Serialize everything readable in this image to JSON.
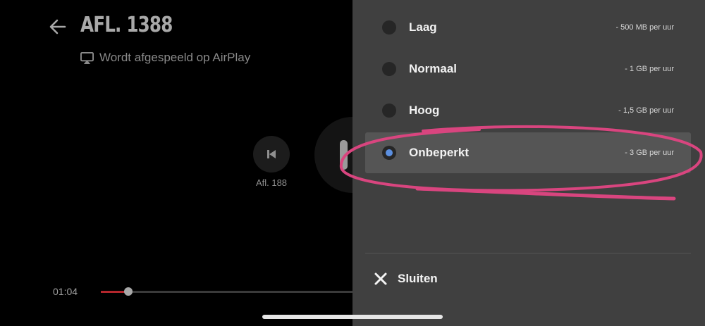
{
  "player": {
    "title": "AFL. 1388",
    "airplay_text": "Wordt afgespeeld op AirPlay",
    "prev_label": "Afl. 188",
    "current_time": "01:04",
    "progress_fraction": 0.11
  },
  "quality_menu": {
    "options": [
      {
        "label": "Laag",
        "size": "- 500 MB per uur",
        "selected": false
      },
      {
        "label": "Normaal",
        "size": "- 1 GB per uur",
        "selected": false
      },
      {
        "label": "Hoog",
        "size": "- 1,5 GB per uur",
        "selected": false
      },
      {
        "label": "Onbeperkt",
        "size": "- 3 GB per uur",
        "selected": true
      }
    ],
    "close_label": "Sluiten"
  },
  "colors": {
    "accent_selected": "#5b8fe0",
    "progress": "#b3262c",
    "annotation": "#d9457f"
  }
}
